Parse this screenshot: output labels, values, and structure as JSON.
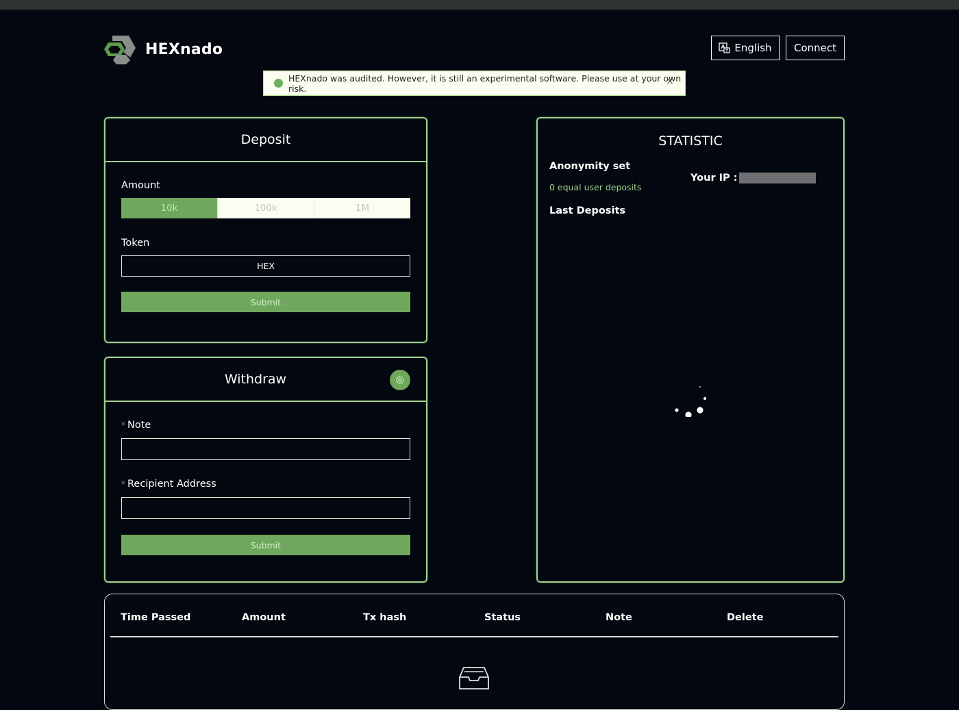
{
  "brand": {
    "name": "HEXnado"
  },
  "header": {
    "language_label": "English",
    "connect_label": "Connect"
  },
  "alert": {
    "message": "HEXnado was audited. However, it is still an experimental software. Please use at your own risk.",
    "close": "×"
  },
  "deposit": {
    "title": "Deposit",
    "amount_label": "Amount",
    "amounts": [
      "10k",
      "100k",
      "1M"
    ],
    "selected_amount": "10k",
    "token_label": "Token",
    "token_value": "HEX",
    "submit_label": "Submit"
  },
  "withdraw": {
    "title": "Withdraw",
    "note_label": "Note",
    "recipient_label": "Recipient Address",
    "required_mark": "*",
    "note_value": "",
    "recipient_value": "",
    "submit_label": "Submit"
  },
  "statistic": {
    "title": "STATISTIC",
    "anonymity_label": "Anonymity set",
    "deposits_text": "0 equal user deposits",
    "last_deposits_label": "Last Deposits",
    "ip_label": "Your IP :"
  },
  "history_table": {
    "columns": [
      "Time Passed",
      "Amount",
      "Tx hash",
      "Status",
      "Note",
      "Delete"
    ],
    "rows": []
  },
  "colors": {
    "accent": "#6fa85c",
    "border": "#9fd18b",
    "background": "#03070f"
  }
}
